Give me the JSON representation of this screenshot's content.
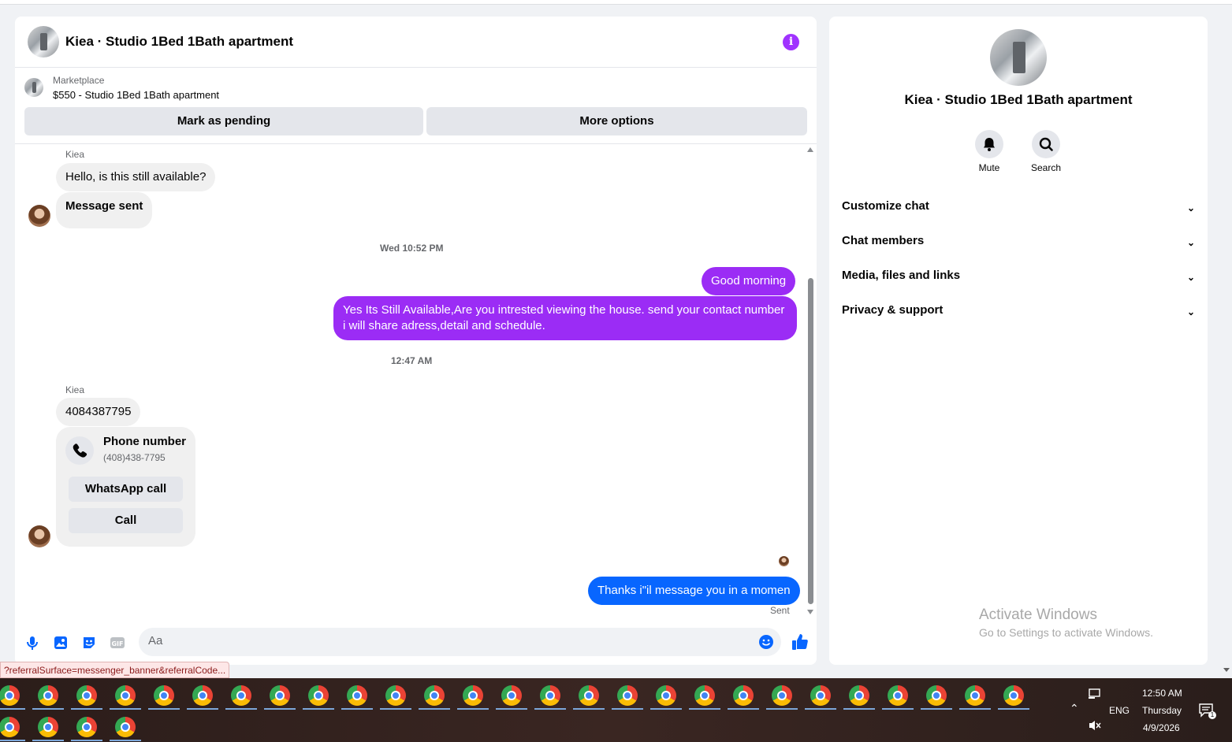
{
  "chat": {
    "title": "Kiea · Studio 1Bed 1Bath apartment",
    "marketplace_label": "Marketplace",
    "listing": "$550 - Studio 1Bed 1Bath apartment",
    "mark_pending": "Mark as pending",
    "more_options": "More options",
    "messages": {
      "sender1": "Kiea",
      "m1": "Hello, is this still available?",
      "m2": "Message sent",
      "ts1": "Wed 10:52 PM",
      "m3": "Good morning",
      "m4": "Yes Its Still Available,Are you intrested viewing the house. send your contact number i will share adress,detail and schedule.",
      "ts2": "12:47 AM",
      "sender2": "Kiea",
      "m5": "4084387795",
      "phone_card_title": "Phone number",
      "phone_card_number": "(408)438-7795",
      "whatsapp_call": "WhatsApp call",
      "call": "Call",
      "m6": "Thanks i\"il message you in a momen",
      "sent_status": "Sent"
    },
    "composer_placeholder": "Aa"
  },
  "side": {
    "title": "Kiea · Studio 1Bed 1Bath apartment",
    "mute": "Mute",
    "search": "Search",
    "sections": [
      "Customize chat",
      "Chat members",
      "Media, files and links",
      "Privacy & support"
    ]
  },
  "activate": {
    "line1": "Activate Windows",
    "line2": "Go to Settings to activate Windows."
  },
  "status_url": "?referralSurface=messenger_banner&referralCode...",
  "tray": {
    "lang": "ENG",
    "time": "12:50 AM",
    "day": "Thursday",
    "date": "4/9/2026",
    "notif_count": "1"
  },
  "colors": {
    "accent_purple": "#9b2cf5",
    "accent_blue": "#0866ff"
  }
}
